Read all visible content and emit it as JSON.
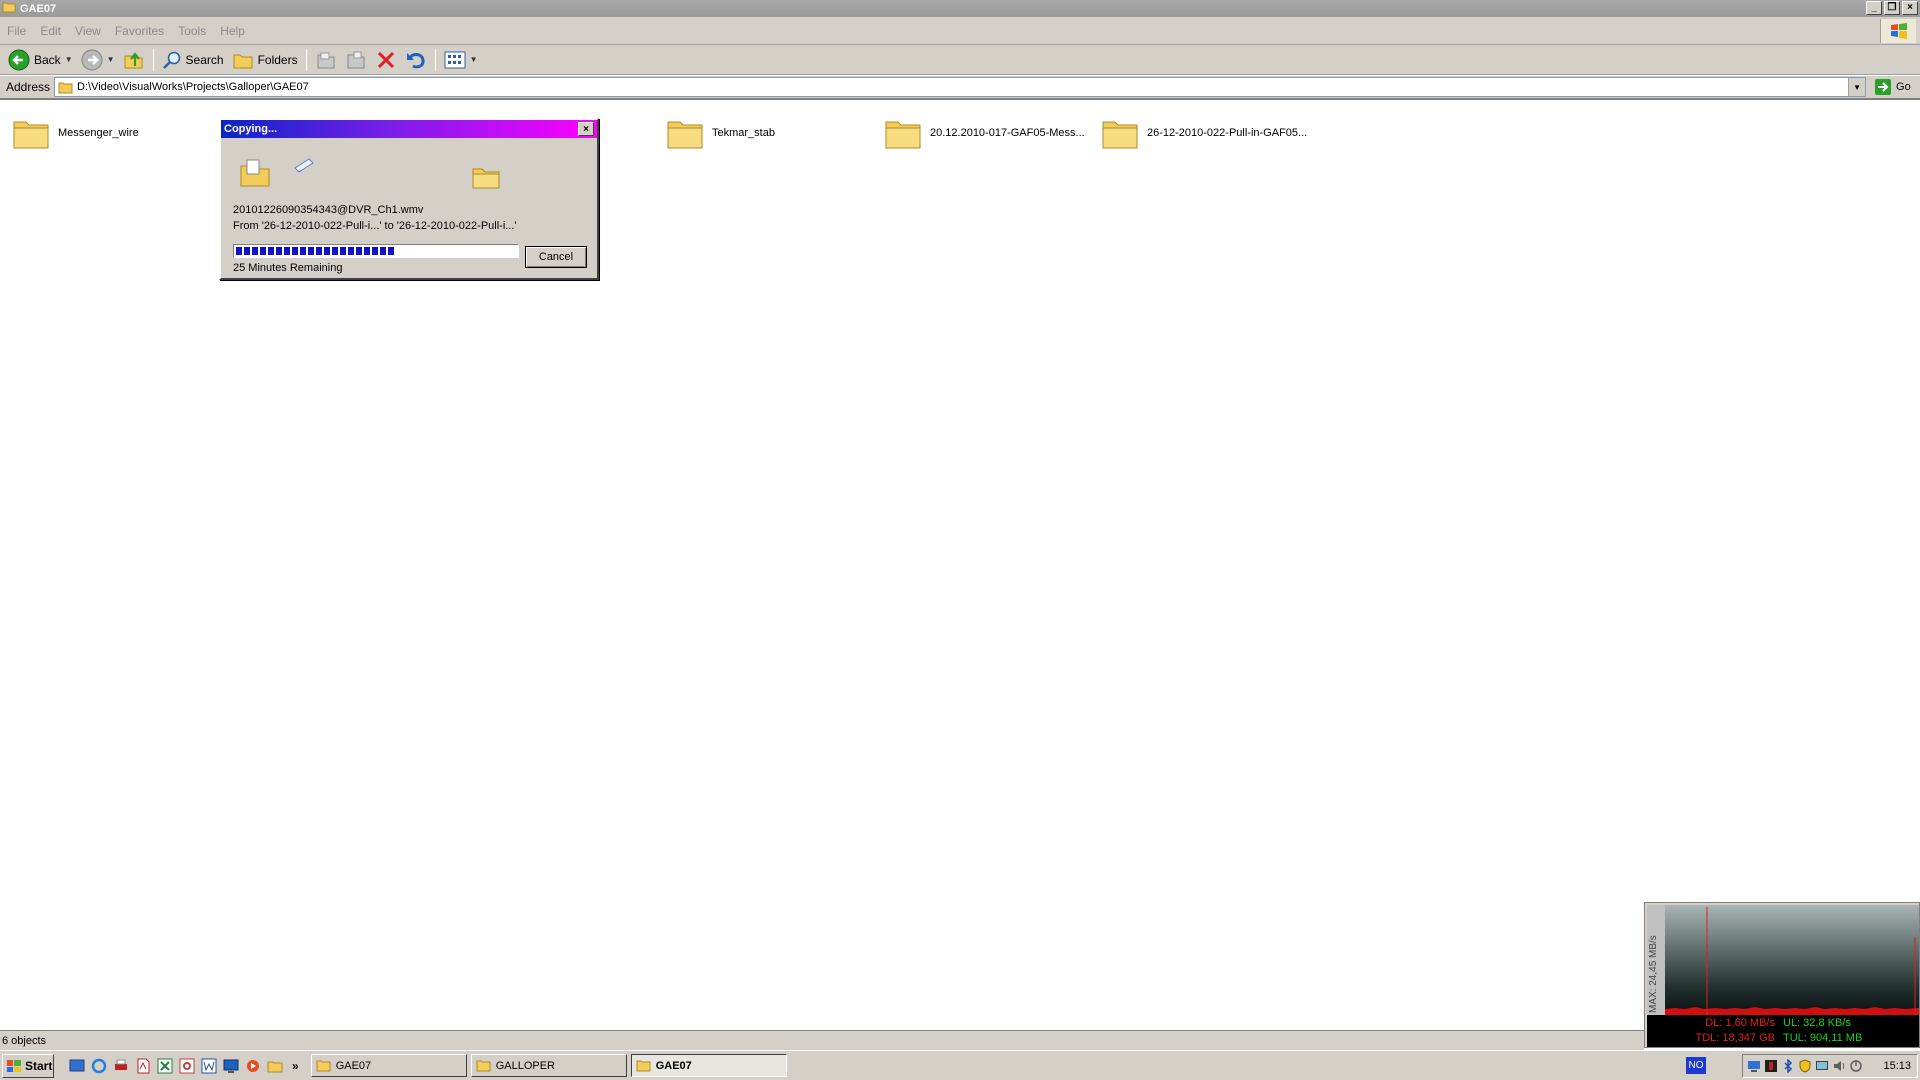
{
  "window": {
    "title": "GAE07",
    "minimize": "_",
    "restore": "❐",
    "close": "×"
  },
  "menu": [
    {
      "label": "File"
    },
    {
      "label": "Edit"
    },
    {
      "label": "View"
    },
    {
      "label": "Favorites"
    },
    {
      "label": "Tools"
    },
    {
      "label": "Help"
    }
  ],
  "toolbar": {
    "back_label": "Back",
    "search_label": "Search",
    "folders_label": "Folders"
  },
  "address": {
    "label": "Address",
    "path": "D:\\Video\\VisualWorks\\Projects\\Galloper\\GAE07",
    "go_label": "Go"
  },
  "folders": [
    {
      "name": "Messenger_wire"
    },
    {
      "name": "Tekmar_stab"
    },
    {
      "name": "20.12.2010-017-GAF05-Mess..."
    },
    {
      "name": "26-12-2010-022-Pull-in-GAF05..."
    }
  ],
  "copy_dialog": {
    "title": "Copying...",
    "filename": "20101226090354343@DVR_Ch1.wmv",
    "from_to": "From '26-12-2010-022-Pull-i...' to '26-12-2010-022-Pull-i...'",
    "progress": 0.57,
    "remaining": "25 Minutes Remaining",
    "cancel_label": "Cancel"
  },
  "bandwidth": {
    "max_label": "MAX: 24,45 MB/s",
    "dl": "DL: 1,60 MB/s",
    "ul": "UL: 32,8 KB/s",
    "tdl": "TDL: 18,347 GB",
    "tul": "TUL: 904,11 MB"
  },
  "status": {
    "objects": "6 objects"
  },
  "taskbar": {
    "start_label": "Start",
    "more": "»",
    "tasks": [
      {
        "label": "GAE07"
      },
      {
        "label": "GALLOPER"
      },
      {
        "label": "GAE07"
      }
    ],
    "language": "NO",
    "clock": "15:13"
  },
  "colors": {
    "dialog_title_start": "#0a24c8",
    "dialog_title_end": "#ff00ff",
    "progress_fill": "#1010c8",
    "folder": "#f3cc5a"
  }
}
